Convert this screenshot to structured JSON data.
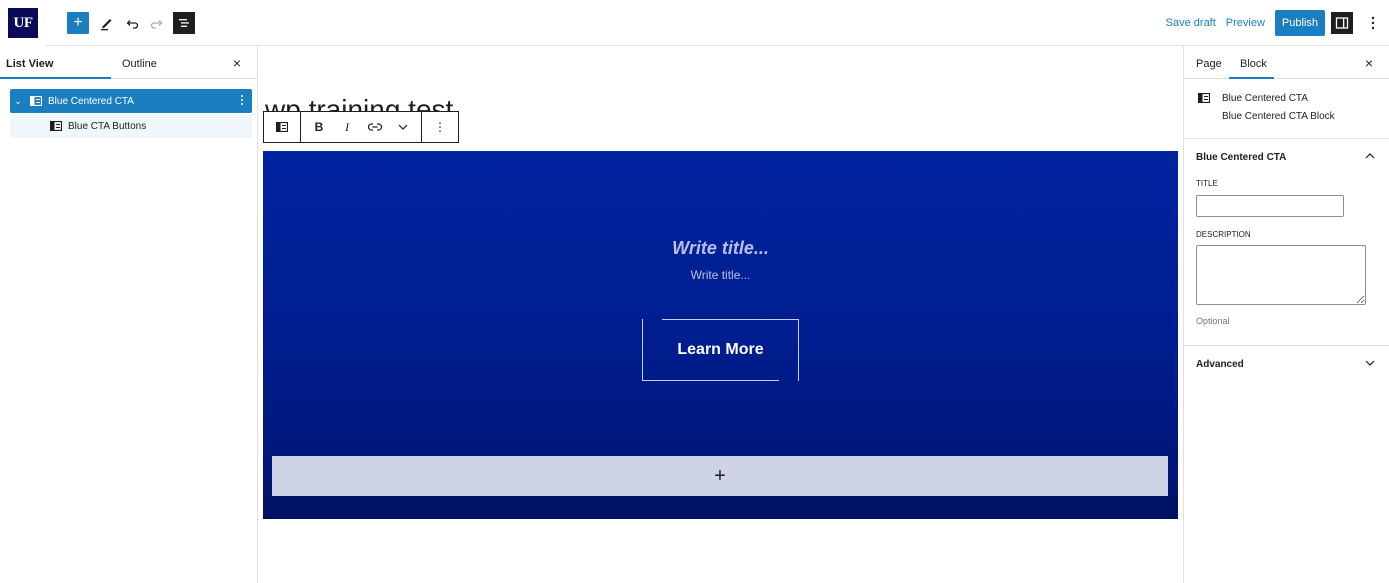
{
  "topbar": {
    "logo_text": "UF",
    "save_draft": "Save draft",
    "preview": "Preview",
    "publish": "Publish",
    "icons": [
      "add-block-icon",
      "edit-tools-icon",
      "undo-icon",
      "redo-icon",
      "document-outline-icon",
      "settings-panel-icon",
      "options-kebab-icon"
    ]
  },
  "left_panel": {
    "tabs": [
      "List View",
      "Outline"
    ],
    "close": "×",
    "tree": [
      {
        "label": "Blue Centered CTA",
        "selected": true
      },
      {
        "label": "Blue CTA Buttons",
        "selected": false
      }
    ]
  },
  "editor": {
    "post_title": "wp training test",
    "toolbar": {
      "bold": "B",
      "italic": "I",
      "more": "⋮"
    },
    "cta": {
      "title_placeholder": "Write title...",
      "subtitle_placeholder": "Write title...",
      "button_label": "Learn More",
      "appender": "+"
    }
  },
  "right_panel": {
    "tabs": [
      "Page",
      "Block"
    ],
    "close": "×",
    "block_name": "Blue Centered CTA",
    "block_description": "Blue Centered CTA Block",
    "section_title": "Blue Centered CTA",
    "fields": {
      "title_label": "TITLE",
      "title_value": "",
      "description_label": "DESCRIPTION",
      "description_value": "",
      "help_text": "Optional"
    },
    "advanced": "Advanced"
  },
  "colors": {
    "accent": "#1a7ec0",
    "cta_blue": "#0023a0",
    "cta_blue_dark": "#001060",
    "logo_navy": "#0a0a5a",
    "appender_bg": "#cfd3e6"
  }
}
